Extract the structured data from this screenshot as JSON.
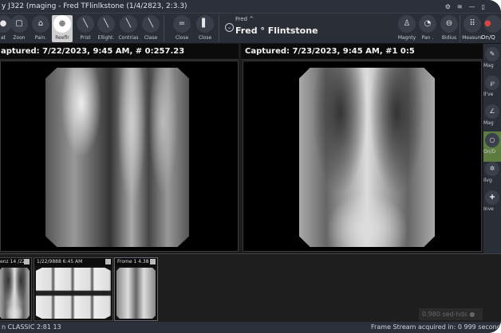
{
  "window": {
    "title": "y J322 (maging - Fred TFlinlkstone (1/4/2823, 2:3.3)"
  },
  "toolbar": {
    "left_buttons": [
      {
        "label": "at",
        "icon": "circle-icon"
      },
      {
        "label": "Zoon",
        "icon": "zoom-square-icon"
      },
      {
        "label": "Pain.",
        "icon": "pan-icon"
      },
      {
        "label": "Reeflr",
        "icon": "reflect-icon",
        "selected": true
      },
      {
        "label": "Prist",
        "icon": "brush-icon"
      },
      {
        "label": "Ellight.",
        "icon": "brightness-icon"
      },
      {
        "label": "Contrias",
        "icon": "contrast-icon"
      },
      {
        "label": "Clase",
        "icon": "clear-icon"
      }
    ],
    "close_buttons": [
      {
        "label": "Close",
        "icon": "equals-icon"
      },
      {
        "label": "Close",
        "icon": "panel-icon"
      }
    ],
    "right_buttons": [
      {
        "label": "Magnty",
        "icon": "magnify-icon"
      },
      {
        "label": "Pan .",
        "icon": "pan-circle-icon"
      },
      {
        "label": "Bidius",
        "icon": "radius-icon"
      },
      {
        "label": "Measure",
        "icon": "grid-icon"
      },
      {
        "label": "On/Q",
        "icon": "record-icon"
      }
    ]
  },
  "patient": {
    "small": "Fred ^",
    "name": "Fred ° Flintstone"
  },
  "viewer": {
    "left": {
      "caption": "aptured: 7/22/2023, 9:45 AM, #  0:257.23"
    },
    "right": {
      "caption": "Captured: 7/23/2023, 9:45 AM, #1 0:5"
    }
  },
  "sidebar": {
    "items": [
      {
        "label": "Mag",
        "icon": "pen-icon"
      },
      {
        "label": "Il've",
        "icon": "lasso-icon"
      },
      {
        "label": "Mag",
        "icon": "angle-icon"
      },
      {
        "label": "On/D",
        "icon": "dot-icon",
        "selected": true
      },
      {
        "label": "Ilvg",
        "icon": "star-icon"
      },
      {
        "label": "Inve",
        "icon": "plus-icon"
      }
    ]
  },
  "thumbnails": [
    {
      "label": "enz 14 /223"
    },
    {
      "label": "1/22/9888 6:45 AM"
    },
    {
      "label": "Frome 1  4.38"
    }
  ],
  "fps": "0.980 sed-hds",
  "status": {
    "left": "n CLASSIC 2:81 13",
    "right": "Frame Stream acquired in: 0 999 seconds"
  },
  "colors": {
    "toolbar": "#2a2e37",
    "selected_sidebar": "#5c7d3f",
    "background": "#1c1c1e"
  }
}
